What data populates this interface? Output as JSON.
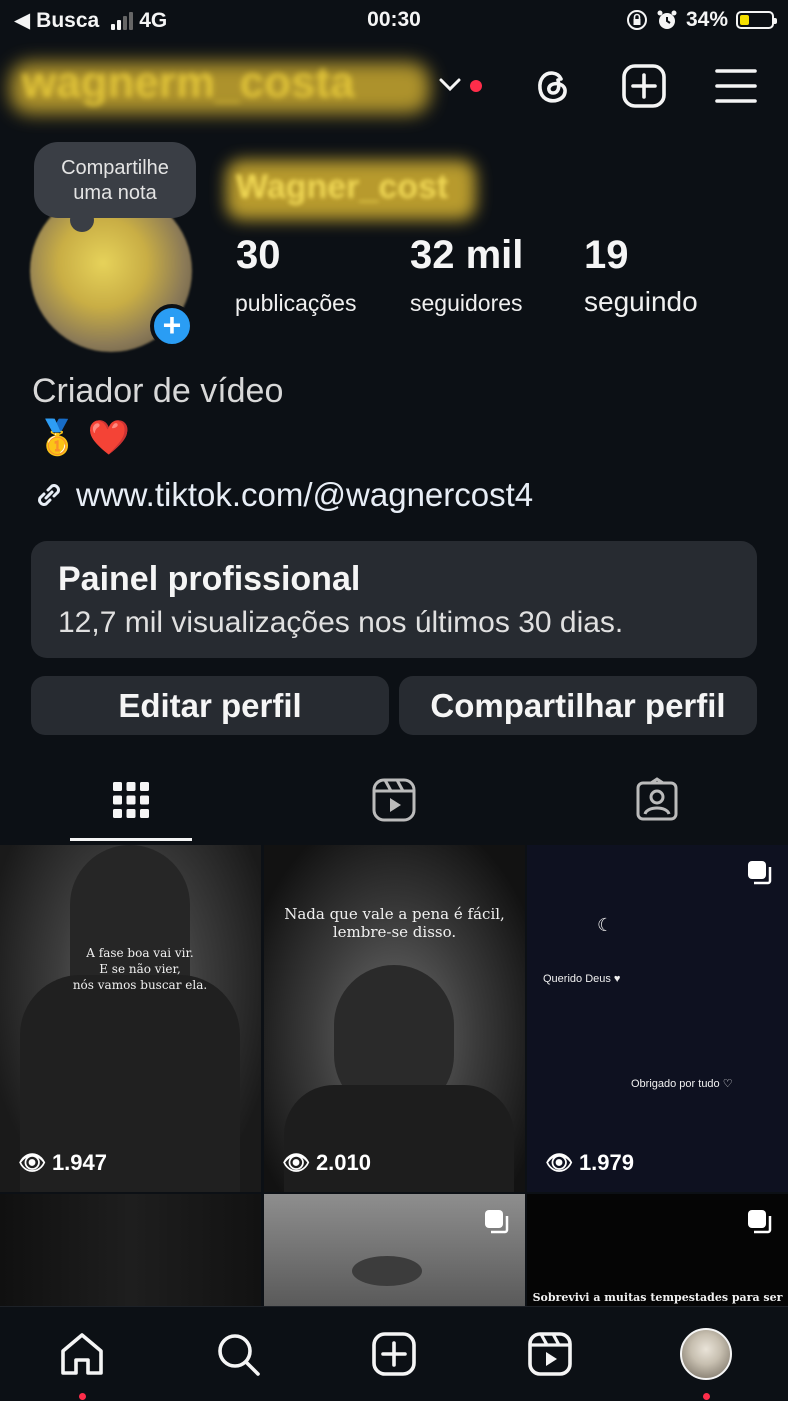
{
  "status_bar": {
    "back_app": "Busca",
    "network": "4G",
    "time": "00:30",
    "battery": "34%"
  },
  "header": {
    "username": "wagnerm_costa"
  },
  "profile": {
    "note_bubble": "Compartilhe uma nota",
    "display_name": "Wagner_cost",
    "stats": [
      {
        "value": "30",
        "label": "publicações"
      },
      {
        "value": "32 mil",
        "label": "seguidores"
      },
      {
        "value": "19",
        "label": "seguindo"
      }
    ],
    "category": "Criador de vídeo",
    "emoji_line": "🥇 ❤️",
    "link": "www.tiktok.com/@wagnercost4"
  },
  "dashboard": {
    "title": "Painel profissional",
    "subtitle": "12,7 mil visualizações nos últimos 30 dias."
  },
  "buttons": {
    "edit": "Editar perfil",
    "share": "Compartilhar perfil"
  },
  "tabs": [
    "grid-icon",
    "reels-icon",
    "tagged-icon"
  ],
  "posts": [
    {
      "text": "A fase boa vai vir.\nE se não vier,\nnós vamos buscar ela.",
      "views": "1.947"
    },
    {
      "text": "Nada que vale a pena é fácil,\nlembre-se disso.",
      "views": "2.010"
    },
    {
      "text_top": "Querido Deus ♥",
      "text_bottom": "Obrigado por tudo ♡",
      "views": "1.979"
    },
    {
      "text": ""
    },
    {
      "text": ""
    },
    {
      "text": "Sobrevivi a muitas tempestades para ser"
    }
  ],
  "colors": {
    "background": "#0c1015",
    "card": "#272b31",
    "accent_blue": "#2a9df4",
    "notification_red": "#ff2d4a"
  }
}
